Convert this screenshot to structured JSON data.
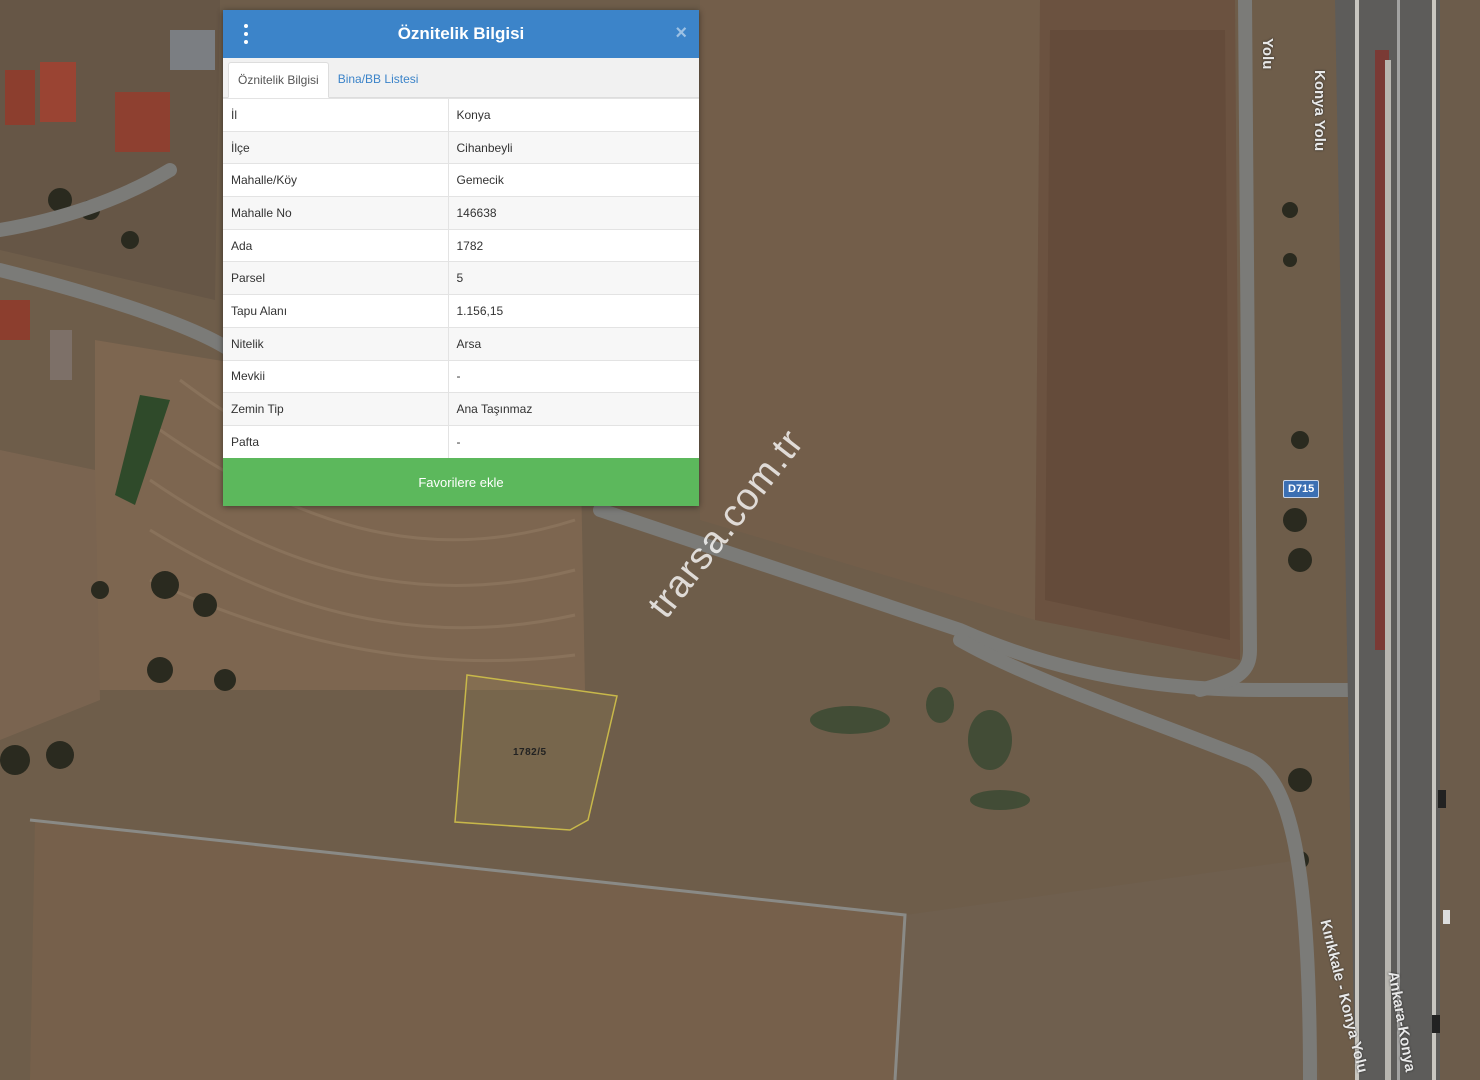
{
  "popup": {
    "title": "Öznitelik Bilgisi",
    "tabs": [
      {
        "label": "Öznitelik Bilgisi",
        "active": true
      },
      {
        "label": "Bina/BB Listesi",
        "active": false
      }
    ],
    "rows": [
      {
        "key": "İl",
        "value": "Konya"
      },
      {
        "key": "İlçe",
        "value": "Cihanbeyli"
      },
      {
        "key": "Mahalle/Köy",
        "value": "Gemecik"
      },
      {
        "key": "Mahalle No",
        "value": "146638"
      },
      {
        "key": "Ada",
        "value": "1782"
      },
      {
        "key": "Parsel",
        "value": "5"
      },
      {
        "key": "Tapu Alanı",
        "value": "1.156,15"
      },
      {
        "key": "Nitelik",
        "value": "Arsa"
      },
      {
        "key": "Mevkii",
        "value": "-"
      },
      {
        "key": "Zemin Tip",
        "value": "Ana Taşınmaz"
      },
      {
        "key": "Pafta",
        "value": "-"
      }
    ],
    "favorite_button": "Favorilere ekle"
  },
  "map": {
    "parcel_label": "1782/5",
    "road_shield": "D715",
    "road_labels": [
      "Konya Yolu",
      "Yolu",
      "Kırıkkale - Konya Yolu",
      "Ankara-Konya"
    ],
    "watermark": "trarsa.com.tr"
  },
  "colors": {
    "header": "#3c84c9",
    "button": "#5cb85c",
    "parcel_outline": "#c8b84a"
  }
}
